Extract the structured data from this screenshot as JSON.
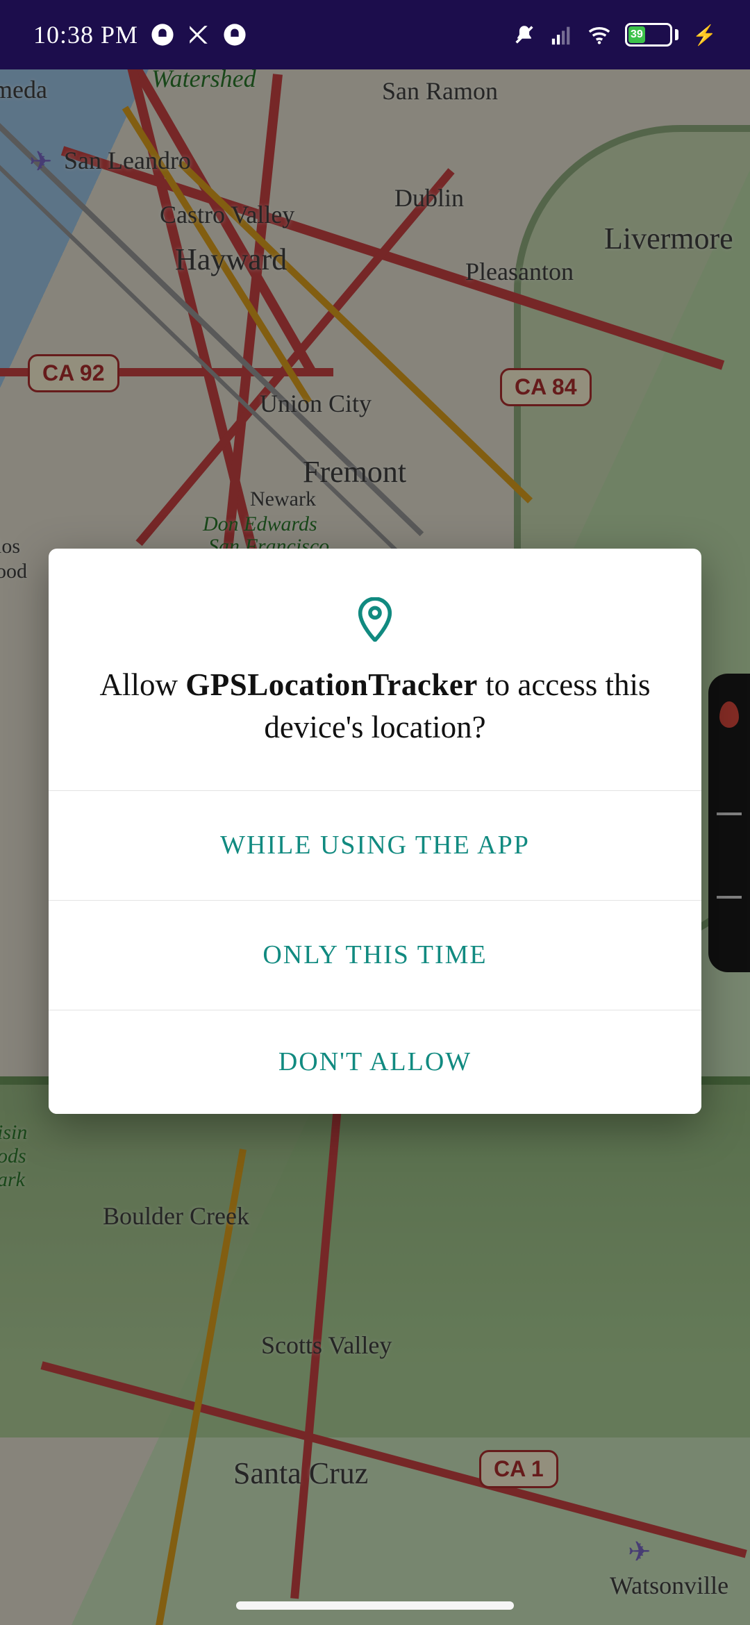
{
  "status_bar": {
    "time": "10:38 PM",
    "battery_percent": "39"
  },
  "map": {
    "cities": {
      "meda": "meda",
      "watershed": "Watershed",
      "san_ramon": "San Ramon",
      "san_leandro": "San Leandro",
      "dublin": "Dublin",
      "castro_valley": "Castro Valley",
      "livermore": "Livermore",
      "hayward": "Hayward",
      "pleasanton": "Pleasanton",
      "union_city": "Union City",
      "fremont": "Fremont",
      "newark": "Newark",
      "don_edwards": "Don Edwards",
      "san_francisco": "San Francisco",
      "los": "los",
      "ood": "ood",
      "isin": "isin",
      "ods": "ods",
      "ark": "ark",
      "boulder_creek": "Boulder Creek",
      "scotts_valley": "Scotts Valley",
      "santa_cruz": "Santa Cruz",
      "watsonville": "Watsonville"
    },
    "shields": {
      "ca92": "CA 92",
      "ca84": "CA 84",
      "ca1": "CA 1"
    }
  },
  "dialog": {
    "title_prefix": "Allow ",
    "app_name": "GPSLocationTracker",
    "title_suffix": " to access this device's location?",
    "buttons": {
      "while_using": "WHILE USING THE APP",
      "only_this_time": "ONLY THIS TIME",
      "dont_allow": "DON'T ALLOW"
    }
  },
  "colors": {
    "accent": "#118a80",
    "statusbar_bg": "#1c0d4c"
  }
}
